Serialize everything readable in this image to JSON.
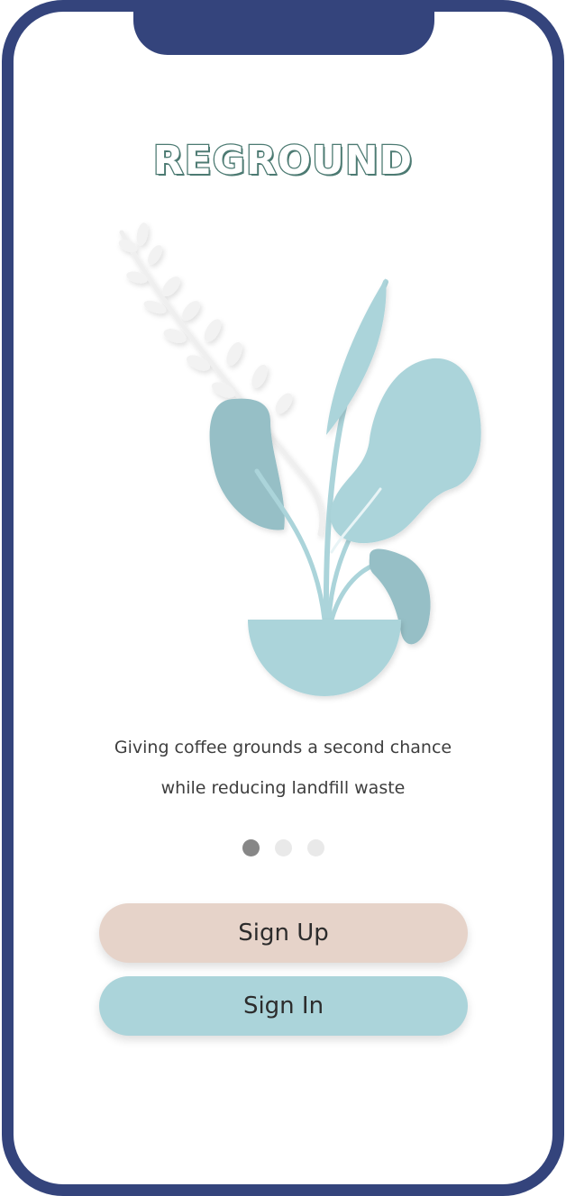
{
  "app": {
    "logo_text": "REGROUND"
  },
  "onboarding": {
    "tagline_line1": "Giving coffee grounds a second chance",
    "tagline_line2": "while reducing landfill waste",
    "page_count": 3,
    "active_page": 1
  },
  "actions": {
    "signup_label": "Sign Up",
    "signin_label": "Sign In"
  },
  "colors": {
    "frame": "#34447c",
    "logo": "#4c7a72",
    "signup_button": "#e6d3c9",
    "signin_button": "#abd4da",
    "plant_light": "#abd4da",
    "plant_dark": "#96bfc6"
  }
}
